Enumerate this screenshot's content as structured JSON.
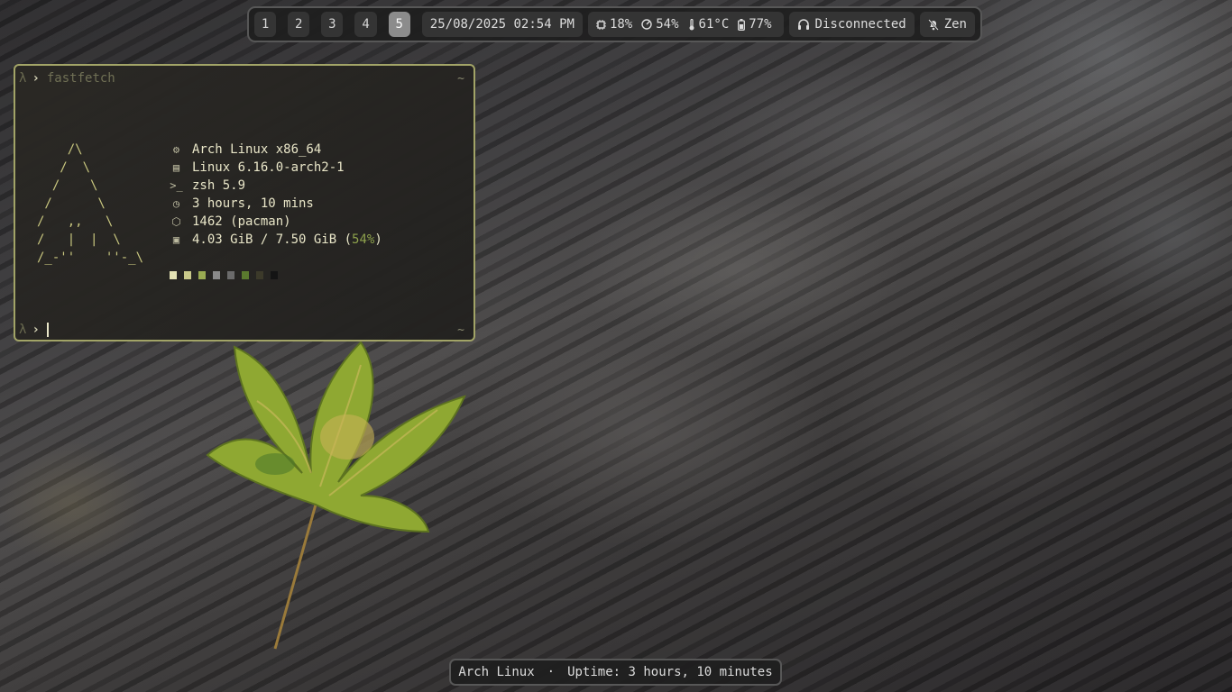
{
  "topbar": {
    "workspaces": [
      "1",
      "2",
      "3",
      "4",
      "5"
    ],
    "active_workspace": "5",
    "datetime": "25/08/2025 02:54 PM",
    "cpu": "18%",
    "memory": "54%",
    "temperature": "61°C",
    "battery": "77%",
    "audio_status": "Disconnected",
    "notification_mode": "Zen",
    "icons": [
      "cpu-icon",
      "gauge-icon",
      "thermometer-icon",
      "battery-icon",
      "headphones-icon",
      "bell-off-icon"
    ]
  },
  "terminal": {
    "prompt_symbol": "λ",
    "prompt_arrow": "›",
    "command": "fastfetch",
    "cwd": "~",
    "ascii_logo": "    /\\\n   /  \\\n  /    \\\n /      \\\n/   ,,   \\\n/   |  |  \\\n/_-''    ''-_\\",
    "info": [
      {
        "icon": "distro-icon",
        "text": "Arch Linux x86_64"
      },
      {
        "icon": "kernel-icon",
        "text": "Linux 6.16.0-arch2-1"
      },
      {
        "icon": "shell-icon",
        "text": "zsh 5.9"
      },
      {
        "icon": "clock-icon",
        "text": "3 hours, 10 mins"
      },
      {
        "icon": "package-icon",
        "text": "1462 (pacman)"
      },
      {
        "icon": "memory-icon",
        "text": "4.03 GiB / 7.50 GiB (",
        "highlight": "54%",
        "suffix": ")"
      }
    ],
    "palette": [
      "#e3e2b4",
      "#c9c98a",
      "#9aab52",
      "#8a8a8a",
      "#6b6b6b",
      "#5a7a2e",
      "#3c3a2a",
      "#141414"
    ]
  },
  "bottombar": {
    "os": "Arch Linux",
    "separator": "·",
    "uptime": "Uptime: 3 hours, 10 minutes"
  },
  "colors": {
    "terminal_border": "#a2a467",
    "accent_green": "#8ea24c",
    "bar_border": "#575757"
  }
}
